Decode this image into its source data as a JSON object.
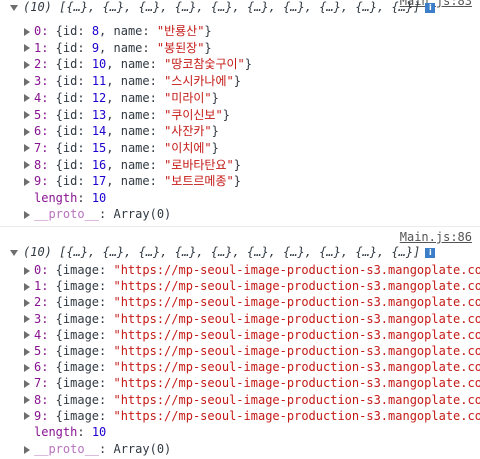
{
  "messages": [
    {
      "source": "Main.js:83",
      "summary": "(10) [{…}, {…}, {…}, {…}, {…}, {…}, {…}, {…}, {…}, {…}]",
      "items": [
        {
          "index": "0:",
          "rest": " {id: ",
          "id": "8",
          "mid": ", name: ",
          "value": "\"반룡산\"",
          "close": "}"
        },
        {
          "index": "1:",
          "rest": " {id: ",
          "id": "9",
          "mid": ", name: ",
          "value": "\"봉된장\"",
          "close": "}"
        },
        {
          "index": "2:",
          "rest": " {id: ",
          "id": "10",
          "mid": ", name: ",
          "value": "\"땅코참숯구이\"",
          "close": "}"
        },
        {
          "index": "3:",
          "rest": " {id: ",
          "id": "11",
          "mid": ", name: ",
          "value": "\"스시카나에\"",
          "close": "}"
        },
        {
          "index": "4:",
          "rest": " {id: ",
          "id": "12",
          "mid": ", name: ",
          "value": "\"미라이\"",
          "close": "}"
        },
        {
          "index": "5:",
          "rest": " {id: ",
          "id": "13",
          "mid": ", name: ",
          "value": "\"쿠이신보\"",
          "close": "}"
        },
        {
          "index": "6:",
          "rest": " {id: ",
          "id": "14",
          "mid": ", name: ",
          "value": "\"사잔카\"",
          "close": "}"
        },
        {
          "index": "7:",
          "rest": " {id: ",
          "id": "15",
          "mid": ", name: ",
          "value": "\"이치에\"",
          "close": "}"
        },
        {
          "index": "8:",
          "rest": " {id: ",
          "id": "16",
          "mid": ", name: ",
          "value": "\"로바타탄요\"",
          "close": "}"
        },
        {
          "index": "9:",
          "rest": " {id: ",
          "id": "17",
          "mid": ", name: ",
          "value": "\"보트르메종\"",
          "close": "}"
        }
      ],
      "length_key": "length",
      "length_value": "10",
      "proto_key": "__proto__",
      "proto_value": ": Array(0)"
    },
    {
      "source": "Main.js:86",
      "summary": "(10) [{…}, {…}, {…}, {…}, {…}, {…}, {…}, {…}, {…}, {…}]",
      "items": [
        {
          "index": "0:",
          "rest": " {image: ",
          "value": "\"https://mp-seoul-image-production-s3.mangoplate.co…"
        },
        {
          "index": "1:",
          "rest": " {image: ",
          "value": "\"https://mp-seoul-image-production-s3.mangoplate.co…"
        },
        {
          "index": "2:",
          "rest": " {image: ",
          "value": "\"https://mp-seoul-image-production-s3.mangoplate.co…"
        },
        {
          "index": "3:",
          "rest": " {image: ",
          "value": "\"https://mp-seoul-image-production-s3.mangoplate.co…"
        },
        {
          "index": "4:",
          "rest": " {image: ",
          "value": "\"https://mp-seoul-image-production-s3.mangoplate.co…"
        },
        {
          "index": "5:",
          "rest": " {image: ",
          "value": "\"https://mp-seoul-image-production-s3.mangoplate.co…"
        },
        {
          "index": "6:",
          "rest": " {image: ",
          "value": "\"https://mp-seoul-image-production-s3.mangoplate.co…"
        },
        {
          "index": "7:",
          "rest": " {image: ",
          "value": "\"https://mp-seoul-image-production-s3.mangoplate.co…"
        },
        {
          "index": "8:",
          "rest": " {image: ",
          "value": "\"https://mp-seoul-image-production-s3.mangoplate.co…"
        },
        {
          "index": "9:",
          "rest": " {image: ",
          "value": "\"https://mp-seoul-image-production-s3.mangoplate.co…"
        }
      ],
      "length_key": "length",
      "length_value": "10",
      "proto_key": "__proto__",
      "proto_value": ": Array(0)"
    }
  ],
  "colors": {
    "key": "#881391",
    "number": "#1c00cf",
    "string": "#c41a16",
    "info_badge": "#3c7fc8"
  },
  "icons": [
    "collapse-triangle-icon",
    "expand-triangle-icon",
    "info-icon"
  ]
}
